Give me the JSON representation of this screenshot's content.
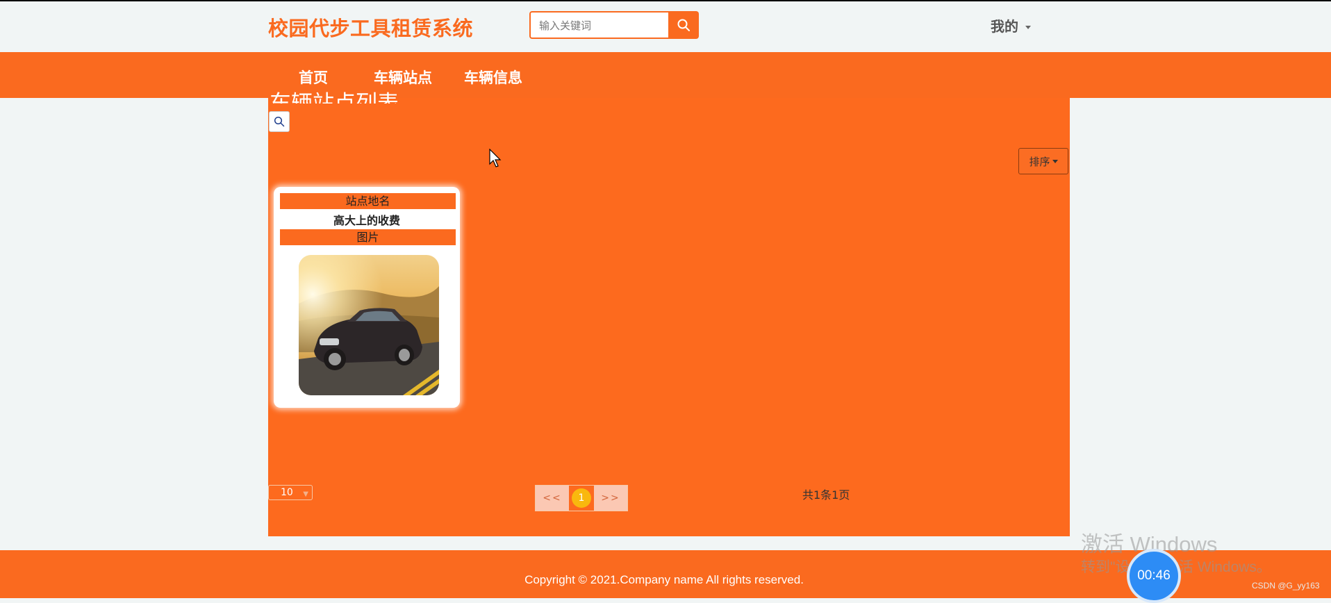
{
  "header": {
    "site_title": "校园代步工具租赁系统",
    "search_placeholder": "输入关键词",
    "user_menu": "我的"
  },
  "nav": {
    "items": [
      {
        "label": "首页"
      },
      {
        "label": "车辆站点"
      },
      {
        "label": "车辆信息"
      }
    ]
  },
  "main": {
    "title": "车辆站点列表",
    "sort_label": "排序",
    "card": {
      "label_station": "站点地名",
      "station_value": "高大上的收费",
      "label_image": "图片"
    },
    "pagination": {
      "page_size": "10",
      "prev": "<<",
      "current": "1",
      "next": ">>",
      "total": "共1条1页"
    }
  },
  "footer": {
    "copyright": "Copyright © 2021.Company name All rights reserved."
  },
  "overlay": {
    "watermark_line1": "激活 Windows",
    "watermark_line2": "转到\"设置\"以激活 Windows。",
    "timer": "00:46",
    "csdn": "CSDN @G_yy163"
  },
  "colors": {
    "accent": "#fa6a1f",
    "panel": "#fd6a1e",
    "page_bg": "#f1f5f5",
    "current_page": "#f9b80e"
  }
}
